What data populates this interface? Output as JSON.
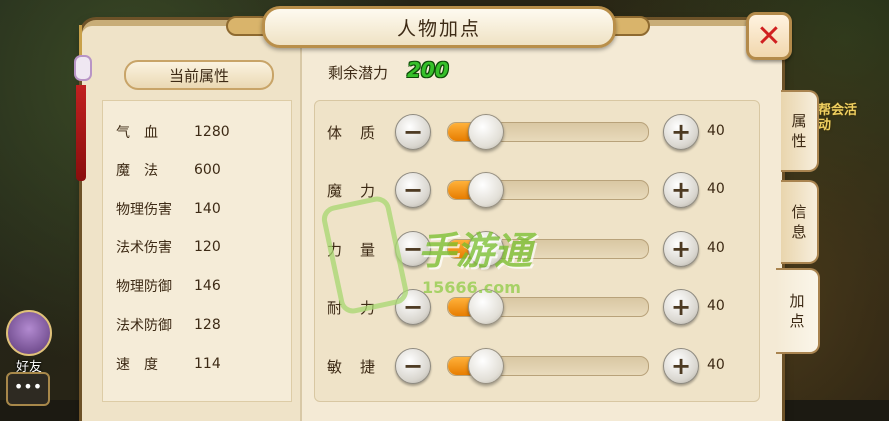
{
  "window": {
    "title": "人物加点",
    "close_icon": "close-icon"
  },
  "left_panel": {
    "tab_label": "当前属性",
    "stats": [
      {
        "label": "气　血",
        "value": "1280"
      },
      {
        "label": "魔　法",
        "value": "600"
      },
      {
        "label": "物理伤害",
        "value": "140"
      },
      {
        "label": "法术伤害",
        "value": "120"
      },
      {
        "label": "物理防御",
        "value": "146"
      },
      {
        "label": "法术防御",
        "value": "128"
      },
      {
        "label": "速　度",
        "value": "114"
      }
    ]
  },
  "potential": {
    "label": "剩余潜力",
    "value": "200"
  },
  "attributes": [
    {
      "label": "体质",
      "value": "40",
      "fill_fraction": 0.1
    },
    {
      "label": "魔力",
      "value": "40",
      "fill_fraction": 0.1
    },
    {
      "label": "力量",
      "value": "40",
      "fill_fraction": 0.1
    },
    {
      "label": "耐力",
      "value": "40",
      "fill_fraction": 0.1
    },
    {
      "label": "敏捷",
      "value": "40",
      "fill_fraction": 0.1
    }
  ],
  "side_tabs": [
    {
      "label": "属性"
    },
    {
      "label": "信息"
    },
    {
      "label": "加点"
    }
  ],
  "bottom_left": {
    "friend_label": "好友",
    "chat_icon": "chat-icon"
  },
  "deco": {
    "right_text": "帮会活动"
  },
  "watermark": {
    "main": "手游通",
    "sub": "15666.com"
  },
  "colors": {
    "potential_green": "#36c02a",
    "slider_fill": "#e77d00",
    "close_red": "#d02020"
  }
}
